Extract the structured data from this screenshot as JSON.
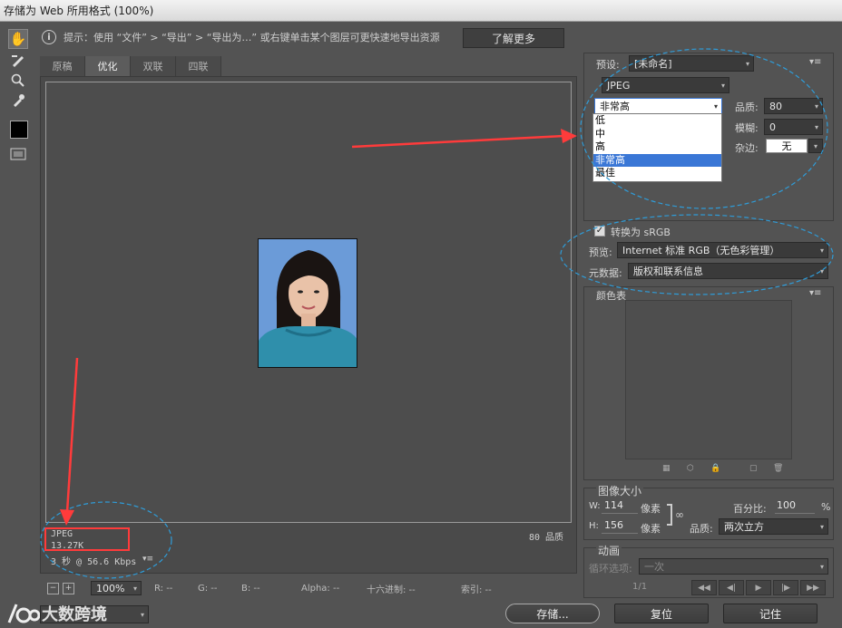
{
  "window": {
    "title": "存储为 Web 所用格式 (100%)"
  },
  "hint": {
    "text": "提示：使用 “文件” > “导出” > “导出为…” 或右键单击某个图层可更快速地导出资源",
    "learn_more": "了解更多"
  },
  "tabs": [
    "原稿",
    "优化",
    "双联",
    "四联"
  ],
  "image_info": {
    "format": "JPEG",
    "size": "13.27K",
    "speed": "3 秒 @ 56.6 Kbps",
    "quality_label": "80 品质"
  },
  "status": {
    "zoom": "100%",
    "r": "R: --",
    "g": "G: --",
    "b": "B: --",
    "alpha": "Alpha: --",
    "hex": "十六进制: --",
    "index": "索引: --"
  },
  "preset": {
    "label": "预设:",
    "value": "[未命名]"
  },
  "format": {
    "value": "JPEG"
  },
  "quality_level": {
    "value": "非常高",
    "options": [
      "低",
      "中",
      "高",
      "非常高",
      "最佳"
    ],
    "selected_index": 3
  },
  "quality": {
    "label": "品质:",
    "value": "80"
  },
  "blur": {
    "label": "模糊:",
    "value": "0"
  },
  "matte": {
    "label": "杂边:",
    "value": "无"
  },
  "convert_srgb": {
    "label": "转换为 sRGB",
    "checked": true
  },
  "preview": {
    "label": "预览:",
    "value": "Internet 标准 RGB（无色彩管理）"
  },
  "metadata": {
    "label": "元数据:",
    "value": "版权和联系信息"
  },
  "color_table": {
    "label": "颜色表"
  },
  "image_size": {
    "label": "图像大小",
    "w_label": "W:",
    "w_value": "114",
    "h_label": "H:",
    "h_value": "156",
    "unit": "像素",
    "percent_label": "百分比:",
    "percent_value": "100",
    "percent_unit": "%",
    "quality_label": "品质:",
    "quality_value": "两次立方"
  },
  "animation": {
    "label": "动画",
    "loop_label": "循环选项:",
    "loop_value": "一次",
    "frame": "1/1"
  },
  "buttons": {
    "save": "存储...",
    "reset": "复位",
    "remember": "记住"
  },
  "watermark": {
    "text": "大数跨境"
  },
  "colors": {
    "accent_red": "#ff3b3b",
    "dashed_blue": "#2f9cd8",
    "highlight": "#3a77d6"
  }
}
